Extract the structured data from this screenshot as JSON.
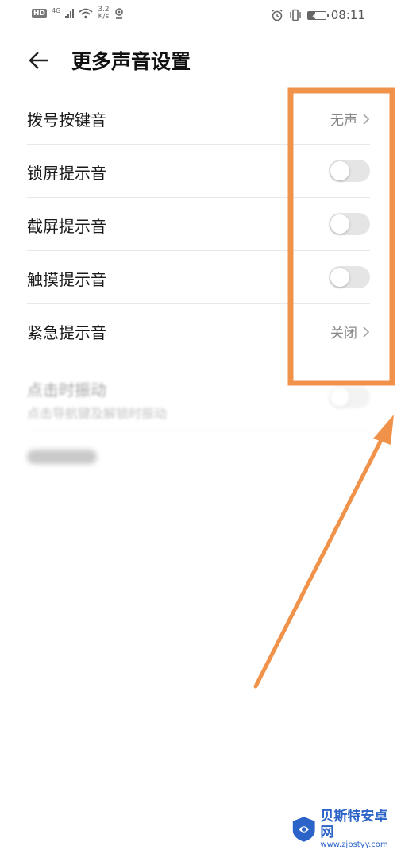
{
  "status_bar": {
    "hd_badge": "HD",
    "network_type": "4G",
    "speed_value": "3.2",
    "speed_unit": "K/s",
    "battery_level": "41",
    "time": "08:11",
    "icons": [
      "signal-icon",
      "wifi-icon",
      "location-icon",
      "alarm-icon",
      "vibrate-icon",
      "battery-icon"
    ]
  },
  "header": {
    "back_icon": "arrow-left-icon",
    "title": "更多声音设置"
  },
  "settings": [
    {
      "label": "拨号按键音",
      "type": "value",
      "value": "无声"
    },
    {
      "label": "锁屏提示音",
      "type": "toggle",
      "on": false
    },
    {
      "label": "截屏提示音",
      "type": "toggle",
      "on": false
    },
    {
      "label": "触摸提示音",
      "type": "toggle",
      "on": false
    },
    {
      "label": "紧急提示音",
      "type": "value",
      "value": "关闭"
    }
  ],
  "faded_settings": [
    {
      "label": "点击时振动",
      "sublabel": "点击导航键及解锁时振动",
      "type": "toggle",
      "on": false
    }
  ],
  "colors": {
    "annotation": "#F0924A",
    "toggle_off": "#E5E5E5",
    "watermark": "#2B63C8"
  },
  "watermark": {
    "name": "贝斯特安卓网",
    "url": "www.zjbstyy.com"
  }
}
